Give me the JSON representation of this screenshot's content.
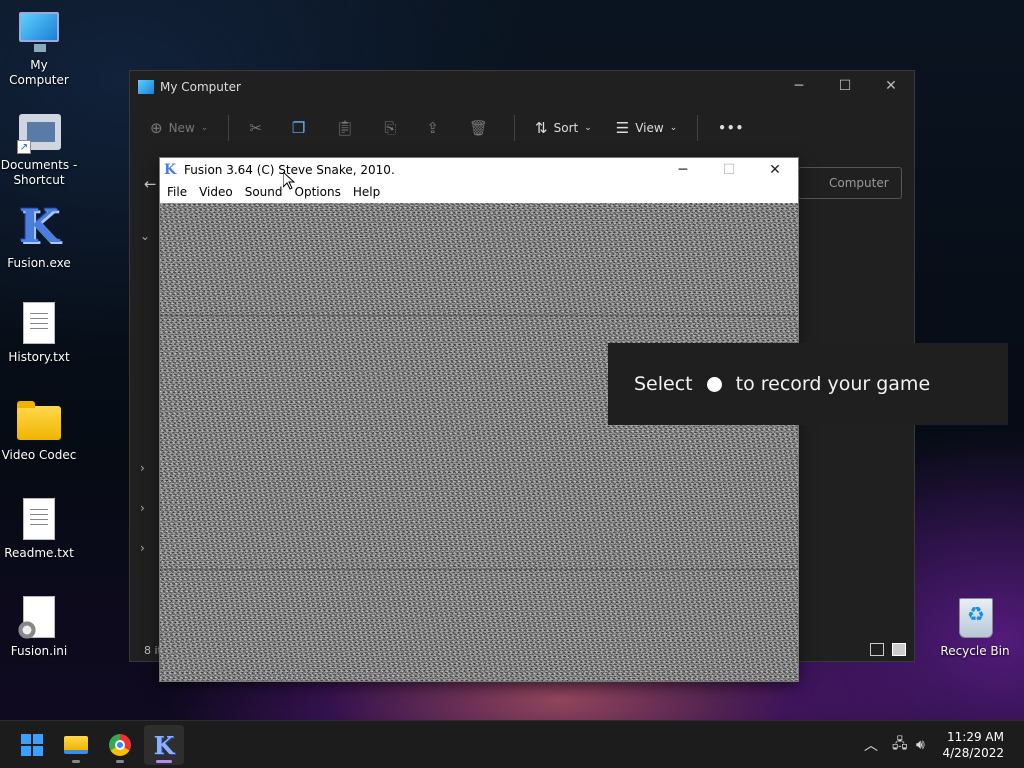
{
  "desktop": {
    "icons": [
      {
        "label": "My Computer"
      },
      {
        "label": "Documents - Shortcut"
      },
      {
        "label": "Fusion.exe"
      },
      {
        "label": "History.txt"
      },
      {
        "label": "Video Codec"
      },
      {
        "label": "Readme.txt"
      },
      {
        "label": "Fusion.ini"
      },
      {
        "label": "Recycle Bin"
      }
    ]
  },
  "explorer": {
    "title": "My Computer",
    "toolbar": {
      "new_label": "New",
      "sort_label": "Sort",
      "view_label": "View",
      "more_label": "•••"
    },
    "address_text": "Computer",
    "status_text": "8 it"
  },
  "fusion": {
    "title": "Fusion 3.64 (C) Steve Snake, 2010.",
    "menu": [
      "File",
      "Video",
      "Sound",
      "Options",
      "Help"
    ]
  },
  "toast": {
    "before": "Select",
    "after": "to record your game"
  },
  "taskbar": {
    "time": "11:29 AM",
    "date": "4/28/2022"
  },
  "colors": {
    "accent": "#3aa0ff",
    "active_indicator": "#b48cf0",
    "toast_bg": "#1f1f1f"
  }
}
